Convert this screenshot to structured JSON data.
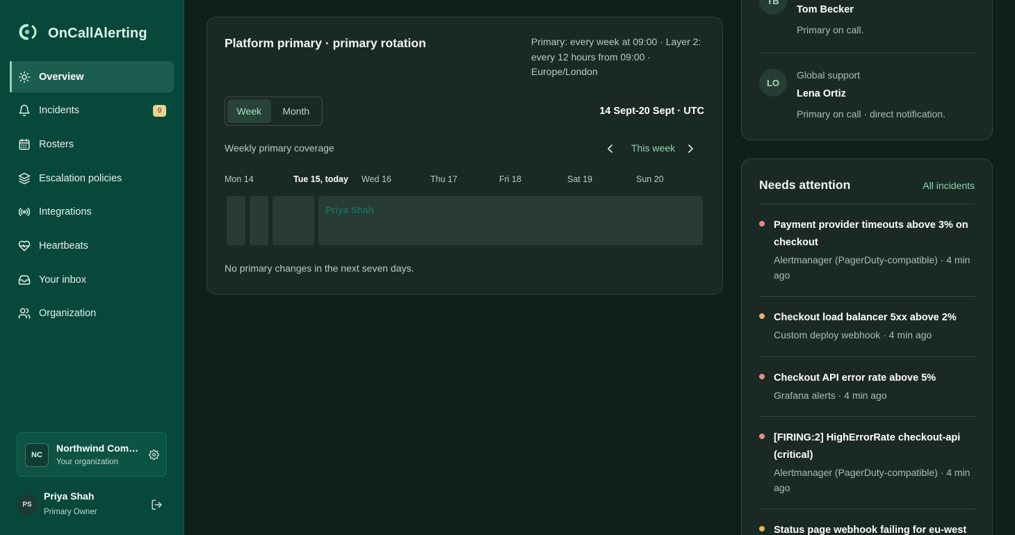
{
  "app": {
    "name": "OnCallAlerting",
    "accent": "#8fd3b4"
  },
  "sidebar": {
    "items": [
      {
        "label": "Overview",
        "icon": "sun-icon",
        "active": true
      },
      {
        "label": "Incidents",
        "icon": "bell-icon",
        "badge": "9"
      },
      {
        "label": "Rosters",
        "icon": "calendar-icon"
      },
      {
        "label": "Escalation policies",
        "icon": "layers-icon"
      },
      {
        "label": "Integrations",
        "icon": "broadcast-icon"
      },
      {
        "label": "Heartbeats",
        "icon": "heartbeat-icon"
      },
      {
        "label": "Your inbox",
        "icon": "inbox-icon"
      },
      {
        "label": "Organization",
        "icon": "users-icon"
      }
    ],
    "org": {
      "initials": "NC",
      "name": "Northwind Com…",
      "sub": "Your organization"
    },
    "user": {
      "initials": "PS",
      "name": "Priya Shah",
      "role": "Primary Owner"
    }
  },
  "rotation": {
    "title": "Platform primary · primary rotation",
    "description": "Primary: every week at 09:00 · Layer 2: every 12 hours from 09:00 · Europe/London",
    "view_tabs": [
      "Week",
      "Month"
    ],
    "active_view": "Week",
    "range": "14 Sept-20 Sept · UTC",
    "coverage_label": "Weekly primary coverage",
    "this_week_label": "This week",
    "days": [
      "Mon 14",
      "Tue 15, today",
      "Wed 16",
      "Thu 17",
      "Fri 18",
      "Sat 19",
      "Sun 20"
    ],
    "shift_person": "Priya Shah",
    "footer": "No primary changes in the next seven days."
  },
  "on_call": {
    "entries": [
      {
        "initials": "TB",
        "team": "",
        "name": "Tom Becker",
        "note": "Primary on call."
      },
      {
        "initials": "LO",
        "team": "Global support",
        "name": "Lena Ortiz",
        "note": "Primary on call · direct notification."
      }
    ]
  },
  "attention": {
    "title": "Needs attention",
    "link": "All incidents",
    "incidents": [
      {
        "title": "Payment provider timeouts above 3% on checkout",
        "source": "Alertmanager (PagerDuty-compatible) · 4 min ago",
        "color": "#e88a7d"
      },
      {
        "title": "Checkout load balancer 5xx above 2%",
        "source": "Custom deploy webhook · 4 min ago",
        "color": "#e3b35e"
      },
      {
        "title": "Checkout API error rate above 5%",
        "source": "Grafana alerts · 4 min ago",
        "color": "#e88a7d"
      },
      {
        "title": "[FIRING:2] HighErrorRate checkout-api (critical)",
        "source": "Alertmanager (PagerDuty-compatible) · 4 min ago",
        "color": "#e88a7d"
      },
      {
        "title": "Status page webhook failing for eu-west",
        "source": "",
        "color": "#e3b35e"
      }
    ]
  }
}
